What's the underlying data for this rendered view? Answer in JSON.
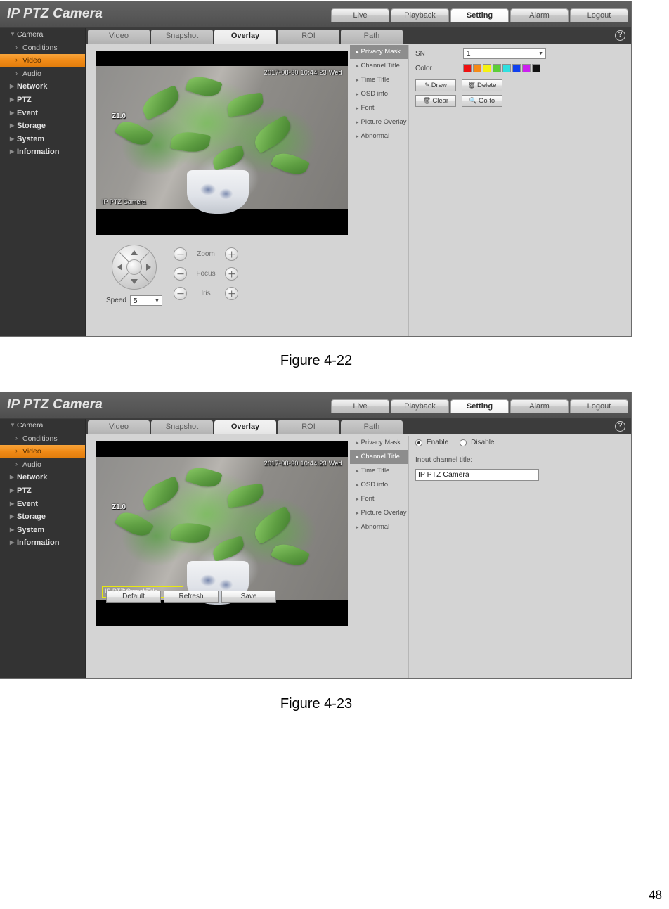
{
  "page": {
    "number": "48"
  },
  "captions": {
    "fig1": "Figure 4-22",
    "fig2": "Figure 4-23"
  },
  "app": {
    "brand": "IP PTZ Camera",
    "topnav": [
      {
        "label": "Live",
        "active": false
      },
      {
        "label": "Playback",
        "active": false
      },
      {
        "label": "Setting",
        "active": true
      },
      {
        "label": "Alarm",
        "active": false
      },
      {
        "label": "Logout",
        "active": false
      }
    ],
    "help_icon": "?",
    "sidebar": [
      {
        "label": "Camera",
        "arrow": "▼",
        "level": "root",
        "selected": false
      },
      {
        "label": "Conditions",
        "arrow": "›",
        "level": "sub",
        "selected": false
      },
      {
        "label": "Video",
        "arrow": "›",
        "level": "sub",
        "selected": true
      },
      {
        "label": "Audio",
        "arrow": "›",
        "level": "sub",
        "selected": false
      },
      {
        "label": "Network",
        "arrow": "▶",
        "level": "root-bold",
        "selected": false
      },
      {
        "label": "PTZ",
        "arrow": "▶",
        "level": "root-bold",
        "selected": false
      },
      {
        "label": "Event",
        "arrow": "▶",
        "level": "root-bold",
        "selected": false
      },
      {
        "label": "Storage",
        "arrow": "▶",
        "level": "root-bold",
        "selected": false
      },
      {
        "label": "System",
        "arrow": "▶",
        "level": "root-bold",
        "selected": false
      },
      {
        "label": "Information",
        "arrow": "▶",
        "level": "root-bold",
        "selected": false
      }
    ],
    "tabs": [
      {
        "label": "Video",
        "active": false
      },
      {
        "label": "Snapshot",
        "active": false
      },
      {
        "label": "Overlay",
        "active": true
      },
      {
        "label": "ROI",
        "active": false
      },
      {
        "label": "Path",
        "active": false
      }
    ],
    "overlay_items": [
      "Privacy Mask",
      "Channel Title",
      "Time Title",
      "OSD info",
      "Font",
      "Picture Overlay",
      "Abnormal"
    ]
  },
  "video": {
    "osd_time": "2017-08-30 10:44:23 Wed",
    "osd_zoom": "Z1.0",
    "osd_channel_title": "IP PTZ Camera",
    "osd_box_overlay": "Channel Title"
  },
  "ptz": {
    "speed_label": "Speed",
    "speed_value": "5",
    "lens": [
      {
        "name": "Zoom"
      },
      {
        "name": "Focus"
      },
      {
        "name": "Iris"
      }
    ]
  },
  "fig1": {
    "selected_overlay_item": "Privacy Mask",
    "sn_label": "SN",
    "sn_value": "1",
    "color_label": "Color",
    "colors": [
      "#ee1111",
      "#f58a17",
      "#f5f211",
      "#5ccd38",
      "#2fe0e0",
      "#1140ee",
      "#cc1ff0",
      "#111111"
    ],
    "buttons": [
      {
        "icon": "✎",
        "label": "Draw"
      },
      {
        "icon": "🗑",
        "label": "Delete"
      },
      {
        "icon": "🗑",
        "label": "Clear"
      },
      {
        "icon": "🔍",
        "label": "Go to"
      }
    ]
  },
  "fig2": {
    "selected_overlay_item": "Channel Title",
    "enable_label": "Enable",
    "disable_label": "Disable",
    "enable_selected": true,
    "input_label": "Input channel title:",
    "input_value": "IP PTZ Camera",
    "actions": [
      "Default",
      "Refresh",
      "Save"
    ]
  }
}
